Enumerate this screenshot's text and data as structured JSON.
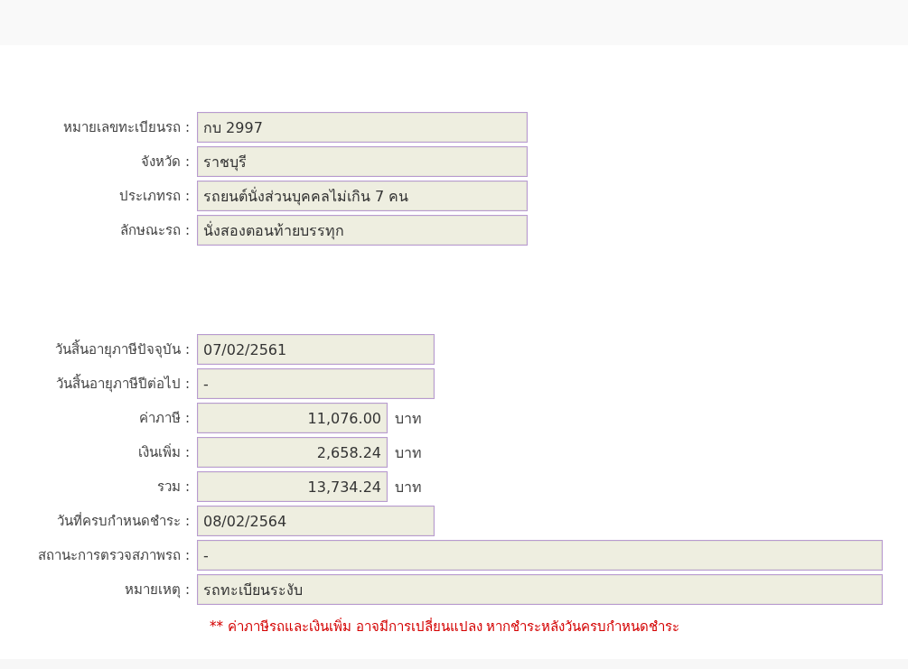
{
  "vehicle": [
    {
      "label": "หมายเลขทะเบียนรถ :",
      "value": "กบ 2997",
      "kind": "medium"
    },
    {
      "label": "จังหวัด :",
      "value": "ราชบุรี",
      "kind": "medium"
    },
    {
      "label": "ประเภทรถ :",
      "value": "รถยนต์นั่งส่วนบุคคลไม่เกิน 7 คน",
      "kind": "medium"
    },
    {
      "label": "ลักษณะรถ :",
      "value": "นั่งสองตอนท้ายบรรทุก",
      "kind": "medium"
    }
  ],
  "tax": [
    {
      "label": "วันสิ้นอายุภาษีปัจจุบัน :",
      "value": "07/02/2561",
      "kind": "date"
    },
    {
      "label": "วันสิ้นอายุภาษีปีต่อไป :",
      "value": "-",
      "kind": "date"
    },
    {
      "label": "ค่าภาษี :",
      "value": "11,076.00",
      "kind": "amount",
      "unit": "บาท"
    },
    {
      "label": "เงินเพิ่ม :",
      "value": "2,658.24",
      "kind": "amount",
      "unit": "บาท"
    },
    {
      "label": "รวม :",
      "value": "13,734.24",
      "kind": "amount",
      "unit": "บาท"
    },
    {
      "label": "วันที่ครบกำหนดชำระ :",
      "value": "08/02/2564",
      "kind": "date"
    },
    {
      "label": "สถานะการตรวจสภาพรถ :",
      "value": "-",
      "kind": "wide"
    },
    {
      "label": "หมายเหตุ :",
      "value": "รถทะเบียนระงับ",
      "kind": "wide"
    }
  ],
  "note": "** ค่าภาษีรถและเงินเพิ่ม อาจมีการเปลี่ยนแปลง หากชำระหลังวันครบกำหนดชำระ"
}
